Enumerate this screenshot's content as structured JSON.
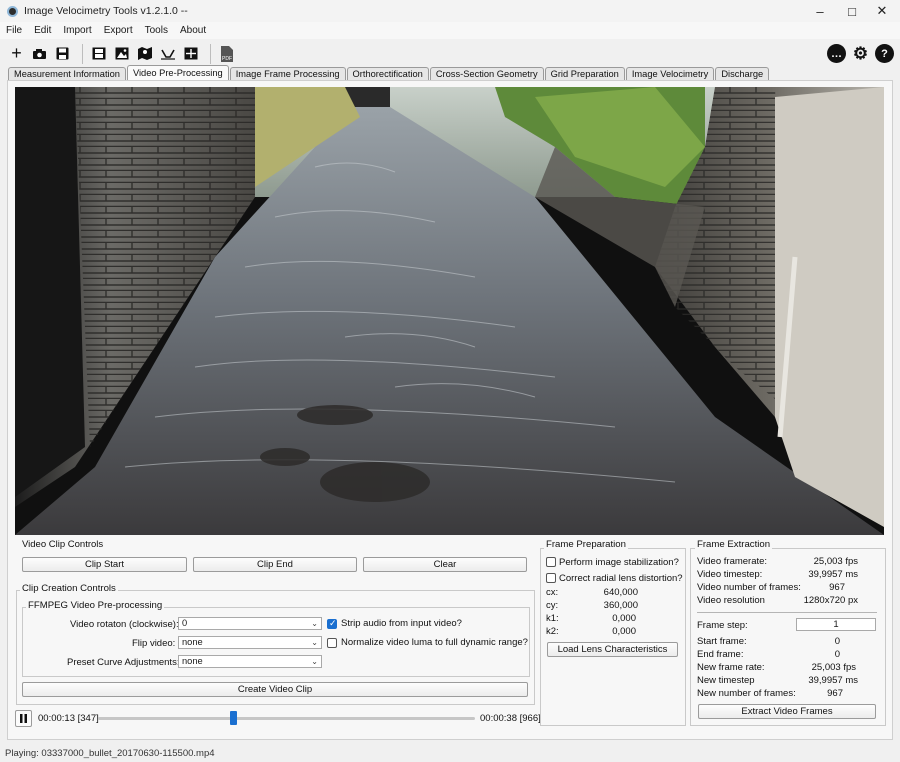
{
  "window": {
    "title": "Image Velocimetry Tools v1.2.1.0 --"
  },
  "menu": [
    "File",
    "Edit",
    "Import",
    "Export",
    "Tools",
    "About"
  ],
  "toolbar": {
    "left_icons": [
      "plus-icon",
      "camera-icon",
      "save-icon",
      "film-icon",
      "image-icon",
      "map-icon",
      "chart-icon",
      "grid-icon",
      "pdf-icon"
    ],
    "pdf_label": "PDF",
    "right_icons": [
      "chat-icon",
      "gear-icon",
      "help-icon"
    ]
  },
  "tabs": [
    {
      "label": "Measurement Information",
      "active": false
    },
    {
      "label": "Video Pre-Processing",
      "active": true
    },
    {
      "label": "Image Frame Processing",
      "active": false
    },
    {
      "label": "Orthorectification",
      "active": false
    },
    {
      "label": "Cross-Section Geometry",
      "active": false
    },
    {
      "label": "Grid Preparation",
      "active": false
    },
    {
      "label": "Image Velocimetry",
      "active": false
    },
    {
      "label": "Discharge",
      "active": false
    }
  ],
  "video_clip_controls": {
    "title": "Video Clip Controls",
    "clip_start": "Clip Start",
    "clip_end": "Clip End",
    "clear": "Clear"
  },
  "clip_creation": {
    "title": "Clip Creation Controls",
    "ffmpeg_title": "FFMPEG Video Pre-processing",
    "rotation_label": "Video rotaton (clockwise):",
    "rotation_value": "0",
    "flip_label": "Flip video:",
    "flip_value": "none",
    "curve_label": "Preset Curve Adjustments:",
    "curve_value": "none",
    "strip_audio_label": "Strip audio from input video?",
    "strip_audio_checked": true,
    "normalize_label": "Normalize video luma to full dynamic range?",
    "normalize_checked": false,
    "create_clip": "Create Video Clip"
  },
  "playback": {
    "current": "00:00:13 [347]",
    "end": "00:00:38 [966]",
    "progress": 0.359
  },
  "frame_preparation": {
    "title": "Frame Preparation",
    "stabilize_label": "Perform image stabilization?",
    "stabilize_checked": false,
    "lens_label": "Correct radial lens distortion?",
    "lens_checked": false,
    "params": [
      {
        "label": "cx:",
        "value": "640,000"
      },
      {
        "label": "cy:",
        "value": "360,000"
      },
      {
        "label": "k1:",
        "value": "0,000"
      },
      {
        "label": "k2:",
        "value": "0,000"
      }
    ],
    "load_lens": "Load Lens Characteristics"
  },
  "frame_extraction": {
    "title": "Frame Extraction",
    "info": [
      {
        "label": "Video framerate:",
        "value": "25,003 fps"
      },
      {
        "label": "Video timestep:",
        "value": "39,9957 ms"
      },
      {
        "label": "Video number of frames:",
        "value": "967"
      },
      {
        "label": "Video resolution",
        "value": "1280x720 px"
      }
    ],
    "frame_step_label": "Frame step:",
    "frame_step_value": "1",
    "details": [
      {
        "label": "Start frame:",
        "value": "0"
      },
      {
        "label": "End frame:",
        "value": "0"
      },
      {
        "label": "New frame rate:",
        "value": "25,003 fps"
      },
      {
        "label": "New timestep",
        "value": "39,9957 ms"
      },
      {
        "label": "New number of frames:",
        "value": "967"
      }
    ],
    "extract": "Extract Video Frames"
  },
  "status": "Playing: 03337000_bullet_20170630-115500.mp4",
  "colors": {
    "accent": "#1a6fd0",
    "slider": "#1a6fd0"
  }
}
